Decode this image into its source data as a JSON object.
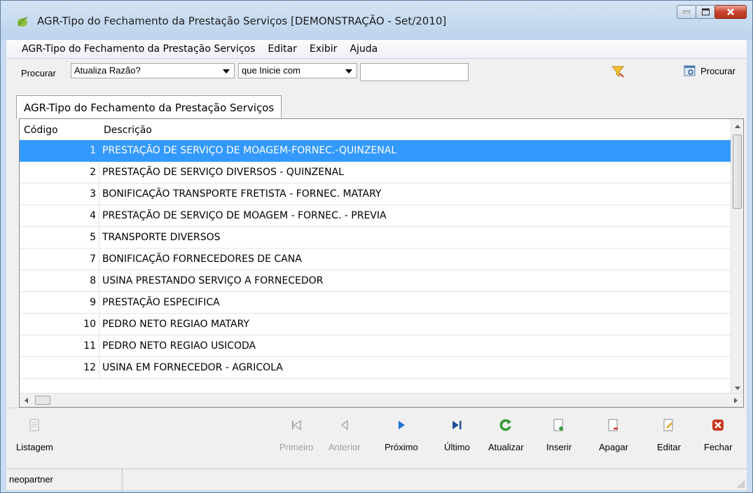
{
  "window": {
    "title": "AGR-Tipo do Fechamento da Prestação Serviços [DEMONSTRAÇÃO - Set/2010]"
  },
  "menu": {
    "items": [
      "AGR-Tipo do Fechamento da Prestação Serviços",
      "Editar",
      "Exibir",
      "Ajuda"
    ]
  },
  "search": {
    "label": "Procurar",
    "field_value": "Atualiza Razão?",
    "condition_value": "que Inicie com",
    "text_value": "",
    "button_label": "Procurar"
  },
  "tab": {
    "label": "AGR-Tipo do Fechamento da Prestação Serviços"
  },
  "grid": {
    "headers": [
      "Código",
      "Descrição"
    ],
    "rows": [
      {
        "code": "1",
        "desc": "PRESTAÇÃO DE SERVIÇO DE MOAGEM-FORNEC.-QUINZENAL"
      },
      {
        "code": "2",
        "desc": "PRESTAÇÃO DE SERVIÇO DIVERSOS -  QUINZENAL"
      },
      {
        "code": "3",
        "desc": "BONIFICAÇÃO TRANSPORTE FRETISTA  -  FORNEC. MATARY"
      },
      {
        "code": "4",
        "desc": "PRESTAÇÃO DE SERVIÇO DE MOAGEM - FORNEC. -  PREVIA"
      },
      {
        "code": "5",
        "desc": "TRANSPORTE DIVERSOS"
      },
      {
        "code": "7",
        "desc": "BONIFICAÇÃO FORNECEDORES DE CANA"
      },
      {
        "code": "8",
        "desc": "USINA PRESTANDO SERVIÇO A  FORNECEDOR"
      },
      {
        "code": "9",
        "desc": "PRESTAÇÃO ESPECIFICA"
      },
      {
        "code": "10",
        "desc": "PEDRO NETO REGIAO MATARY"
      },
      {
        "code": "11",
        "desc": "PEDRO NETO REGIAO USICODA"
      },
      {
        "code": "12",
        "desc": "USINA EM FORNECEDOR - AGRICOLA"
      }
    ]
  },
  "toolbar": {
    "listagem": "Listagem",
    "primeiro": "Primeiro",
    "anterior": "Anterior",
    "proximo": "Próximo",
    "ultimo": "Último",
    "atualizar": "Atualizar",
    "inserir": "Inserir",
    "apagar": "Apagar",
    "editar": "Editar",
    "fechar": "Fechar"
  },
  "status": {
    "user": "neopartner"
  },
  "colors": {
    "selection": "#3399ff",
    "nav_blue": "#1e6fd9",
    "refresh_green": "#2e9b2e",
    "close_red": "#c8361e"
  }
}
